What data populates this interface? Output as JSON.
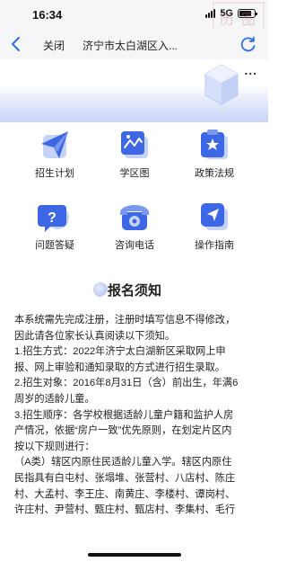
{
  "status_bar": {
    "time": "16:34",
    "network": "5G",
    "battery_level": 0.8
  },
  "nav": {
    "back_icon": "chevron-left-icon",
    "close_label": "关闭",
    "title": "济宁市太白湖区入...",
    "refresh_icon": "refresh-icon",
    "more_label": "..."
  },
  "watermark": [
    "历",
    "图",
    "天",
    "圖"
  ],
  "grid": [
    {
      "label": "招生计划",
      "icon": "paper-plane-icon"
    },
    {
      "label": "学区图",
      "icon": "map-icon"
    },
    {
      "label": "政策法规",
      "icon": "clipboard-star-icon"
    },
    {
      "label": "问题答疑",
      "icon": "question-bubble-icon"
    },
    {
      "label": "咨询电话",
      "icon": "telephone-icon"
    },
    {
      "label": "操作指南",
      "icon": "cursor-arrow-icon"
    }
  ],
  "notice": {
    "title": "报名须知",
    "lines": [
      "本系统需先完成注册，注册时填写信息不得修改，",
      "因此请各位家长认真阅读以下须知。",
      "1.招生方式：2022年济宁太白湖新区采取网上申",
      "报、网上审验和通知录取的方式进行招生录取。",
      "2.招生对象：2016年8月31日（含）前出生，年满6",
      "周岁的适龄儿童。",
      "3.招生顺序：各学校根据适龄儿童户籍和监护人房",
      "产情况，依据“房户一致”优先原则，在划定片区内",
      "按以下规则进行：",
      "（A类）辖区内原住民适龄儿童入学。辖区内原住",
      "民指具有白屯村、张塌堆、张营村、八店村、陈庄",
      "村、大孟村、李王庄、南黄庄、李楼村、谭岗村、",
      "许庄村、尹营村、甄庄村、甄店村、李集村、毛行"
    ]
  }
}
